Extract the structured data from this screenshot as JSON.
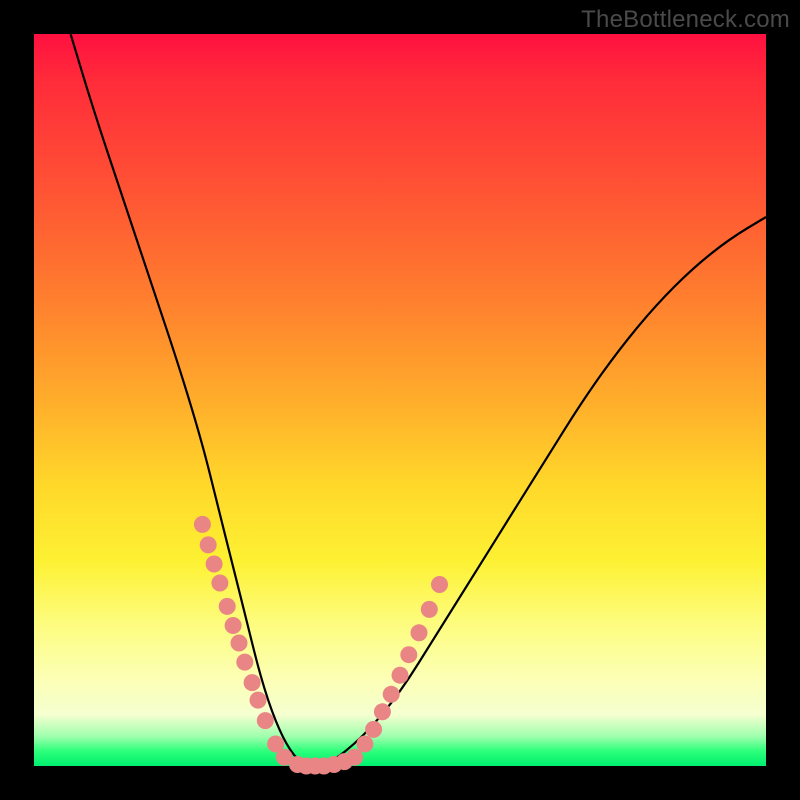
{
  "watermark": "TheBottleneck.com",
  "colors": {
    "background": "#000000",
    "gradient_top": "#ff1040",
    "gradient_mid": "#ffd92a",
    "gradient_bottom": "#00ef6f",
    "curve": "#000000",
    "dots": "#e98585"
  },
  "chart_data": {
    "type": "line",
    "title": "",
    "xlabel": "",
    "ylabel": "",
    "xlim": [
      0,
      100
    ],
    "ylim": [
      0,
      100
    ],
    "series": [
      {
        "name": "bottleneck-curve",
        "x": [
          5,
          8,
          12,
          16,
          20,
          23,
          25,
          27,
          29,
          31,
          33,
          35,
          37,
          40,
          45,
          50,
          55,
          60,
          65,
          70,
          75,
          80,
          85,
          90,
          95,
          100
        ],
        "values": [
          100,
          90,
          78,
          66,
          54,
          44,
          36,
          28,
          20,
          12,
          6,
          2,
          0,
          0,
          4,
          10,
          18,
          26,
          34,
          42,
          50,
          57,
          63,
          68,
          72,
          75
        ]
      }
    ],
    "markers": [
      {
        "name": "left-dots",
        "x": [
          23.0,
          23.8,
          24.6,
          25.4,
          26.4,
          27.2,
          28.0,
          28.8,
          29.8,
          30.6,
          31.6,
          33.0,
          34.2
        ],
        "values": [
          33.0,
          30.2,
          27.6,
          25.0,
          21.8,
          19.2,
          16.8,
          14.2,
          11.4,
          9.0,
          6.2,
          3.0,
          1.2
        ]
      },
      {
        "name": "bottom-dots",
        "x": [
          36.0,
          37.2,
          38.4,
          39.6,
          41.0,
          42.4,
          43.8
        ],
        "values": [
          0.2,
          0.0,
          0.0,
          0.0,
          0.2,
          0.6,
          1.2
        ]
      },
      {
        "name": "right-dots",
        "x": [
          45.2,
          46.4,
          47.6,
          48.8,
          50.0,
          51.2,
          52.6,
          54.0,
          55.4
        ],
        "values": [
          3.0,
          5.0,
          7.4,
          9.8,
          12.4,
          15.2,
          18.2,
          21.4,
          24.8
        ]
      }
    ]
  }
}
